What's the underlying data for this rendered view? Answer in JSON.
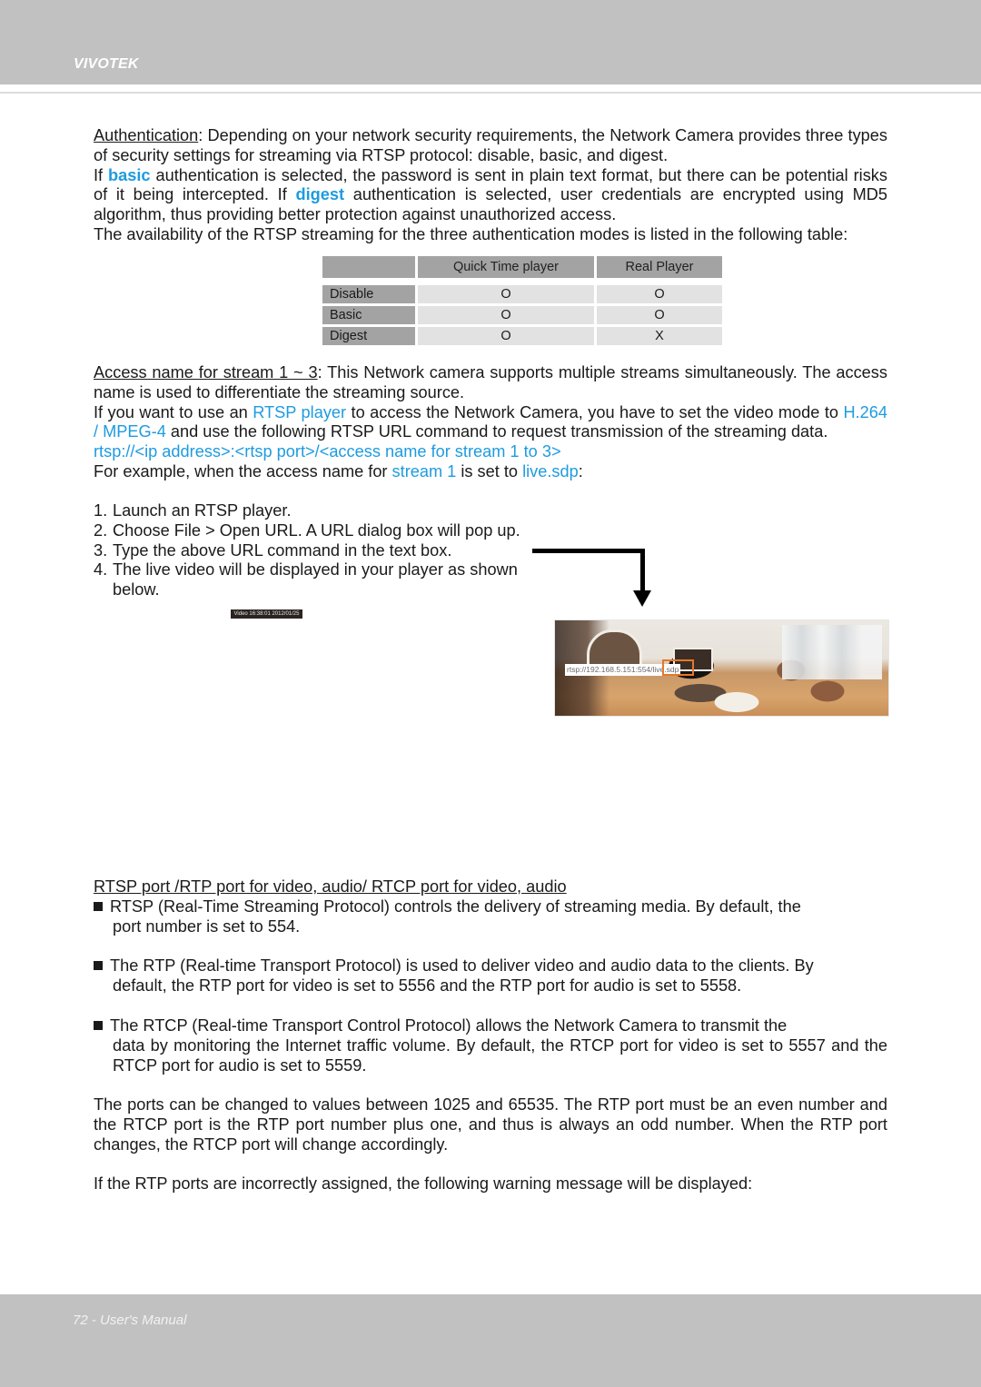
{
  "header": {
    "brand": "VIVOTEK"
  },
  "footer": {
    "page_label": "72 - User's Manual"
  },
  "authentication": {
    "term": "Authentication",
    "intro": ": Depending on your network security requirements, the Network Camera provides three types of security settings for streaming via RTSP protocol: disable, basic, and digest.",
    "basic_pre": "If ",
    "basic_word": "basic",
    "basic_post": " authentication is selected, the password is sent in plain text format, but there can be potential risks of it being intercepted. If ",
    "digest_word": "digest",
    "digest_post": " authentication is selected, user credentials are encrypted using MD5 algorithm, thus providing better protection against unauthorized access.",
    "availability": "The availability of the RTSP streaming for the three authentication modes is listed in the following table:"
  },
  "auth_table": {
    "columns": [
      "",
      "Quick Time player",
      "Real Player"
    ],
    "rows": [
      {
        "mode": "Disable",
        "quicktime": "O",
        "realplayer": "O"
      },
      {
        "mode": "Basic",
        "quicktime": "O",
        "realplayer": "O"
      },
      {
        "mode": "Digest",
        "quicktime": "O",
        "realplayer": "X"
      }
    ]
  },
  "access_name": {
    "term": "Access name for stream 1 ~ 3",
    "intro": ": This Network camera supports multiple streams simultaneously. The access name is used to differentiate the streaming source.",
    "rtsp_pre": "If you want to use an ",
    "rtsp_player": "RTSP player",
    "rtsp_mid": " to access the Network Camera, you have to set the video mode to ",
    "codec": "H.264 / MPEG-4",
    "rtsp_post": " and use the following RTSP URL command to request transmission of the streaming data.",
    "url_template": "rtsp://<ip address>:<rtsp port>/<access name for stream 1 to 3>",
    "example_pre": "For example, when the access name for ",
    "example_stream": "stream 1",
    "example_mid": " is set to ",
    "example_name": "live.sdp",
    "example_post": ":"
  },
  "steps": [
    {
      "num": "1.",
      "text": "Launch an RTSP player."
    },
    {
      "num": "2.",
      "text": "Choose File > Open URL. A URL dialog box will pop up."
    },
    {
      "num": "3.",
      "text": "Type the above URL command in the text box."
    },
    {
      "num": "4.",
      "text": "The live video will be displayed in your player as shown"
    },
    {
      "num": "",
      "text": "below."
    }
  ],
  "video": {
    "caption": "Video 16:38:01 2012/01/25",
    "url_overlay": "rtsp://192.168.5.151:554/live.sdp"
  },
  "ports": {
    "heading": "RTSP port /RTP port for video, audio/ RTCP port for video, audio",
    "bullets": [
      {
        "first": "RTSP (Real-Time Streaming Protocol) controls the delivery of streaming media. By default, the",
        "cont": "port number is set to 554."
      },
      {
        "first": "The RTP (Real-time Transport Protocol) is used to deliver video and audio data to the clients. By",
        "cont": "default, the RTP port for video is set to 5556 and the RTP port for audio is set to 5558."
      },
      {
        "first": "The RTCP (Real-time Transport Control Protocol) allows the Network Camera to transmit the",
        "cont": "data by monitoring the Internet traffic volume. By default, the RTCP port for video is set to 5557 and the RTCP port for audio is set to 5559."
      }
    ],
    "range_note": "The ports can be changed to values between 1025 and 65535. The RTP port must be an even number and the RTCP port is the RTP port number plus one, and thus is always an odd number. When the RTP port changes, the RTCP port will change accordingly.",
    "warning_note": "If the RTP ports are incorrectly assigned, the following warning message will be displayed:"
  }
}
